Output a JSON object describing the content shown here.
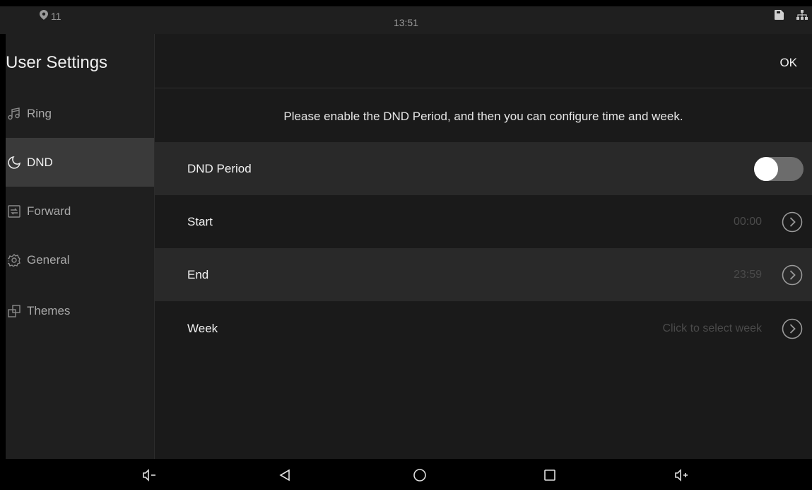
{
  "status_bar": {
    "location_count": "11",
    "time": "13:51",
    "icons": [
      "location-pin-icon",
      "sd-card-icon",
      "network-icon"
    ]
  },
  "sidebar": {
    "title": "User Settings",
    "items": [
      {
        "label": "Ring",
        "icon": "music-note-icon",
        "active": false
      },
      {
        "label": "DND",
        "icon": "moon-icon",
        "active": true
      },
      {
        "label": "Forward",
        "icon": "forward-icon",
        "active": false
      },
      {
        "label": "General",
        "icon": "gear-icon",
        "active": false
      },
      {
        "label": "Themes",
        "icon": "themes-icon",
        "active": false
      }
    ]
  },
  "header": {
    "ok_label": "OK"
  },
  "main": {
    "hint": "Please enable the DND Period, and then you can configure time and week.",
    "rows": [
      {
        "label": "DND Period",
        "type": "toggle",
        "enabled": false
      },
      {
        "label": "Start",
        "value": "00:00"
      },
      {
        "label": "End",
        "value": "23:59"
      },
      {
        "label": "Week",
        "value": "Click to select week"
      }
    ]
  },
  "nav_bar": {
    "buttons": [
      "volume-down-icon",
      "back-icon",
      "home-icon",
      "recents-icon",
      "volume-up-icon"
    ]
  },
  "colors": {
    "background": "#1a1a1a",
    "active_item": "#3a3a3a",
    "shaded_row": "#292929",
    "toggle_track": "#6c6c6c",
    "muted_value": "#4a4a4a"
  }
}
